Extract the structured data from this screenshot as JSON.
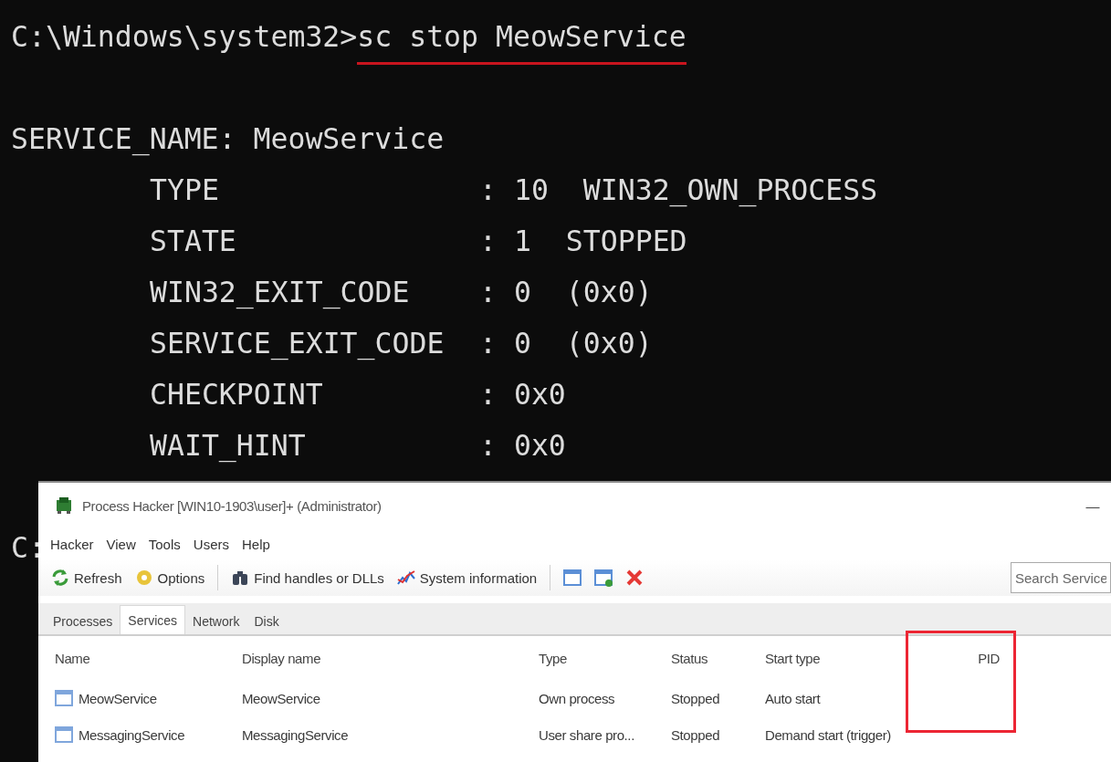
{
  "terminal": {
    "command_line": {
      "prompt": "C:\\Windows\\system32>",
      "command": "sc stop MeowService",
      "underlined": true
    },
    "output": {
      "header": "SERVICE_NAME: MeowService",
      "fields": [
        {
          "name": "TYPE",
          "value": ": 10  WIN32_OWN_PROCESS"
        },
        {
          "name": "STATE",
          "value": ": 1  STOPPED"
        },
        {
          "name": "WIN32_EXIT_CODE",
          "value": ": 0  (0x0)"
        },
        {
          "name": "SERVICE_EXIT_CODE",
          "value": ": 0  (0x0)"
        },
        {
          "name": "CHECKPOINT",
          "value": ": 0x0"
        },
        {
          "name": "WAIT_HINT",
          "value": ": 0x0"
        }
      ]
    },
    "next_prompt": "C:"
  },
  "window": {
    "title": "Process Hacker [WIN10-1903\\user]+ (Administrator)",
    "minimize": "—",
    "menu": [
      "Hacker",
      "View",
      "Tools",
      "Users",
      "Help"
    ],
    "toolbar": [
      {
        "kind": "button",
        "label": "Refresh"
      },
      {
        "kind": "button",
        "label": "Options"
      },
      {
        "kind": "separator"
      },
      {
        "kind": "button",
        "label": "Find handles or DLLs"
      },
      {
        "kind": "button",
        "label": "System information"
      },
      {
        "kind": "separator"
      },
      {
        "kind": "icon"
      },
      {
        "kind": "icon"
      },
      {
        "kind": "icon"
      }
    ],
    "search": {
      "placeholder": "Search Service"
    },
    "tabs": [
      {
        "label": "Processes",
        "selected": false
      },
      {
        "label": "Services",
        "selected": true
      },
      {
        "label": "Network",
        "selected": false
      },
      {
        "label": "Disk",
        "selected": false
      }
    ],
    "table": {
      "columns": [
        {
          "label": "Name",
          "highlighted": false
        },
        {
          "label": "Display name",
          "highlighted": false
        },
        {
          "label": "Type",
          "highlighted": false
        },
        {
          "label": "Status",
          "highlighted": false
        },
        {
          "label": "Start type",
          "highlighted": false
        },
        {
          "label": "PID",
          "highlighted": true
        }
      ],
      "rows": [
        {
          "cells": [
            "MeowService",
            "MeowService",
            "Own process",
            "Stopped",
            "Auto start"
          ]
        },
        {
          "cells": [
            "MessagingService",
            "MessagingService",
            "User share pro...",
            "Stopped",
            "Demand start (trigger)"
          ]
        }
      ]
    }
  }
}
